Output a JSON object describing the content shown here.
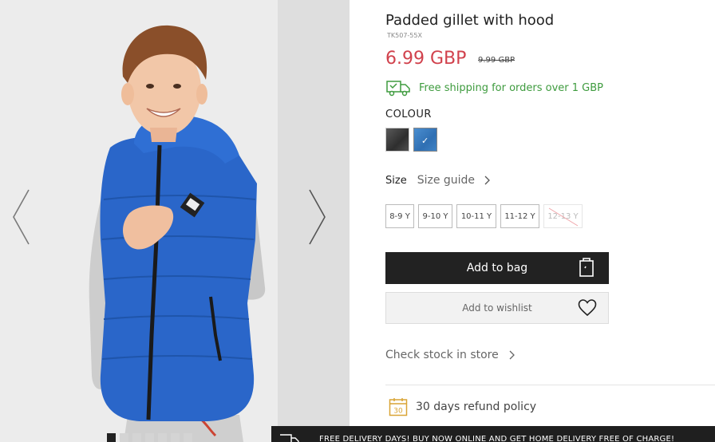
{
  "product": {
    "title": "Padded gillet with hood",
    "sku": "TK507-55X",
    "price": "6.99 GBP",
    "old_price": "9.99 GBP",
    "shipping_text": "Free shipping for orders over 1 GBP"
  },
  "colour": {
    "label": "COLOUR",
    "swatches": [
      {
        "name": "graphite",
        "color": "#3c3c3c",
        "selected": false
      },
      {
        "name": "blue",
        "color": "#3a7bbf",
        "selected": true
      }
    ]
  },
  "size": {
    "label": "Size",
    "guide_label": "Size guide",
    "options": [
      {
        "label": "8-9 Y",
        "available": true
      },
      {
        "label": "9-10 Y",
        "available": true
      },
      {
        "label": "10-11 Y",
        "available": true
      },
      {
        "label": "11-12 Y",
        "available": true
      },
      {
        "label": "12-13 Y",
        "available": false
      }
    ]
  },
  "actions": {
    "add_to_bag": "Add to bag",
    "add_to_wishlist": "Add to wishlist",
    "check_stock": "Check stock in store"
  },
  "refund": {
    "icon_number": "30",
    "text": "30 days refund policy"
  },
  "banner": {
    "text": "FREE DELIVERY DAYS! BUY NOW ONLINE AND GET HOME DELIVERY FREE OF CHARGE!"
  },
  "gallery": {
    "image_count": 7,
    "active_index": 0
  },
  "colors": {
    "price_red": "#d1424d",
    "shipping_green": "#3e9b3e",
    "jacket_blue": "#2a66c9",
    "dark": "#222222"
  },
  "icons": [
    "chevron-left-icon",
    "chevron-right-icon",
    "delivery-truck-icon",
    "chevron-right-icon",
    "shopping-bag-icon",
    "heart-icon",
    "calendar-30-icon",
    "truck-icon"
  ]
}
